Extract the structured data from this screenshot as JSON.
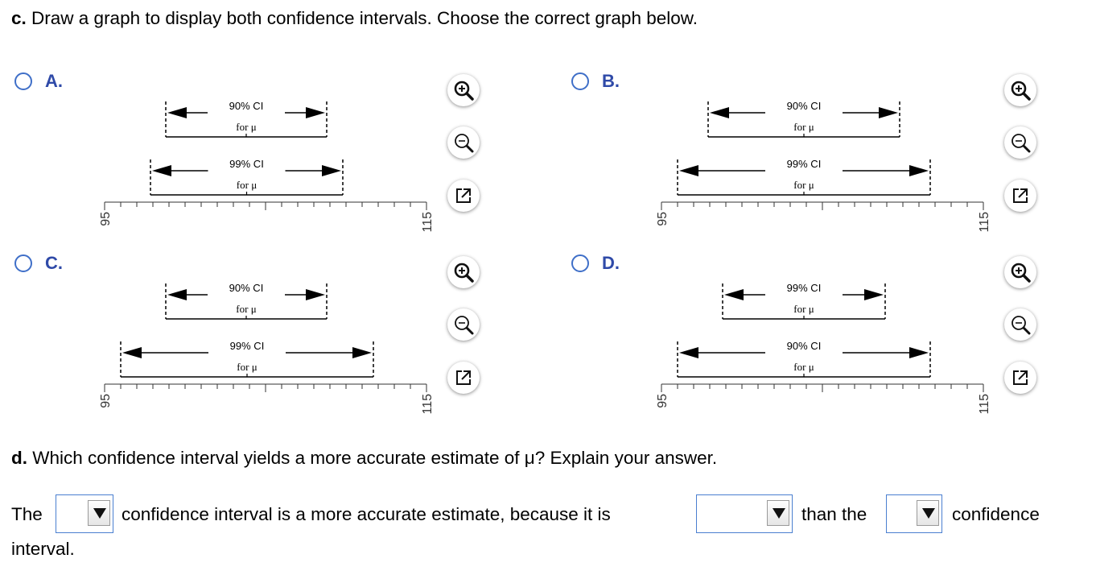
{
  "part_c": {
    "label": "c.",
    "text": "Draw a graph to display both confidence intervals. Choose the correct graph below."
  },
  "options": [
    {
      "letter": "A.",
      "top": {
        "line1": "90% CI",
        "line2": "for μ"
      },
      "bottom": {
        "line1": "99% CI",
        "line2": "for μ"
      },
      "axis": {
        "min_label": "95",
        "max_label": "115"
      }
    },
    {
      "letter": "B.",
      "top": {
        "line1": "90% CI",
        "line2": "for μ"
      },
      "bottom": {
        "line1": "99% CI",
        "line2": "for μ"
      },
      "axis": {
        "min_label": "95",
        "max_label": "115"
      }
    },
    {
      "letter": "C.",
      "top": {
        "line1": "90% CI",
        "line2": "for μ"
      },
      "bottom": {
        "line1": "99% CI",
        "line2": "for μ"
      },
      "axis": {
        "min_label": "95",
        "max_label": "115"
      }
    },
    {
      "letter": "D.",
      "top": {
        "line1": "99% CI",
        "line2": "for μ"
      },
      "bottom": {
        "line1": "90% CI",
        "line2": "for μ"
      },
      "axis": {
        "min_label": "95",
        "max_label": "115"
      }
    }
  ],
  "tools": {
    "zoom_in": "zoom-in-icon",
    "zoom_out": "zoom-out-icon",
    "popout": "popout-icon"
  },
  "part_d": {
    "label": "d.",
    "text": "Which confidence interval yields a more accurate estimate of μ? Explain your answer."
  },
  "answer": {
    "w1": "The",
    "w2": "confidence interval is a more accurate estimate, because it is",
    "w3": "than the",
    "w4": "confidence",
    "w5": "interval.",
    "dropdown1": "",
    "dropdown2": "",
    "dropdown3": ""
  },
  "colors": {
    "accent": "#2f4aa8",
    "radio": "#3f6fc8",
    "dropdown_border": "#4a7fd0"
  }
}
